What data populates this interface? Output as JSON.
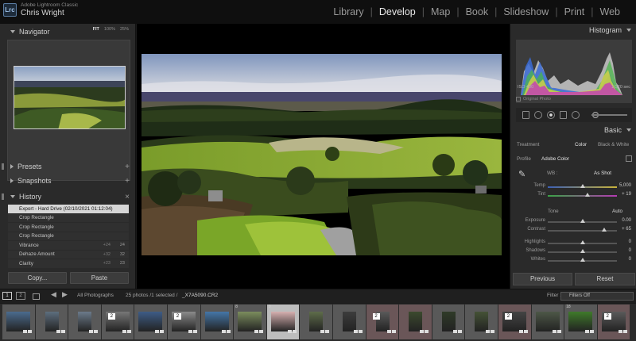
{
  "app": {
    "logo_text": "Lrc",
    "brand": "Adobe Lightroom Classic",
    "user": "Chris Wright",
    "modules": [
      "Library",
      "Develop",
      "Map",
      "Book",
      "Slideshow",
      "Print",
      "Web"
    ],
    "active_module": "Develop"
  },
  "left_panel": {
    "navigator": {
      "title": "Navigator",
      "zoom_options": [
        "FIT",
        "100%",
        "25%"
      ]
    },
    "presets": {
      "title": "Presets"
    },
    "snapshots": {
      "title": "Snapshots"
    },
    "history": {
      "title": "History",
      "items": [
        {
          "label": "Export - Hard Drive (02/10/2021 01:12:04)",
          "delta": "",
          "value": ""
        },
        {
          "label": "Crop Rectangle",
          "delta": "",
          "value": ""
        },
        {
          "label": "Crop Rectangle",
          "delta": "",
          "value": ""
        },
        {
          "label": "Crop Rectangle",
          "delta": "",
          "value": ""
        },
        {
          "label": "Vibrance",
          "delta": "+24",
          "value": "24"
        },
        {
          "label": "Dehaze Amount",
          "delta": "+32",
          "value": "32"
        },
        {
          "label": "Clarity",
          "delta": "+23",
          "value": "23"
        }
      ]
    },
    "copy_label": "Copy...",
    "paste_label": "Paste"
  },
  "right_panel": {
    "histogram": {
      "title": "Histogram",
      "iso": "ISO 400",
      "focal": "124 mm",
      "aperture": "f / 10",
      "shutter": "1/320 sec",
      "original_photo": "Original Photo"
    },
    "basic": {
      "title": "Basic",
      "treatment_label": "Treatment",
      "treatment_color": "Color",
      "treatment_bw": "Black & White",
      "profile_label": "Profile",
      "profile_value": "Adobe Color",
      "wb_label": "WB :",
      "wb_value": "As Shot",
      "tone_label": "Tone",
      "tone_auto": "Auto",
      "sliders": [
        {
          "name": "Temp",
          "value": "5,000",
          "pos": 0.5,
          "gradient": "linear-gradient(90deg,#3b5fb5,#c9b33a)"
        },
        {
          "name": "Tint",
          "value": "+ 19",
          "pos": 0.57,
          "gradient": "linear-gradient(90deg,#3aa346,#b53ab3)"
        },
        {
          "name": "Exposure",
          "value": "0.00",
          "pos": 0.5,
          "gradient": ""
        },
        {
          "name": "Contrast",
          "value": "+ 65",
          "pos": 0.82,
          "gradient": ""
        },
        {
          "name": "Highlights",
          "value": "0",
          "pos": 0.5,
          "gradient": ""
        },
        {
          "name": "Shadows",
          "value": "0",
          "pos": 0.5,
          "gradient": ""
        },
        {
          "name": "Whites",
          "value": "0",
          "pos": 0.5,
          "gradient": ""
        }
      ]
    },
    "previous_label": "Previous",
    "reset_label": "Reset"
  },
  "filmbar": {
    "screen1": "1",
    "screen2": "2",
    "source": "All Photographs",
    "count": "25 photos /1 selected /",
    "filename": "_X7A5090.CR2",
    "filter_label": "Filter :",
    "filter_value": "Filters Off"
  },
  "filmstrip": [
    {
      "num": "",
      "badge": "",
      "style": "landscape",
      "color": "#4b6b8e",
      "tint": ""
    },
    {
      "num": "",
      "badge": "",
      "style": "portrait",
      "color": "#5d6e7e",
      "tint": ""
    },
    {
      "num": "",
      "badge": "",
      "style": "portrait",
      "color": "#6b7a8a",
      "tint": ""
    },
    {
      "num": "",
      "badge": "2",
      "style": "landscape",
      "color": "#777",
      "tint": ""
    },
    {
      "num": "",
      "badge": "",
      "style": "landscape",
      "color": "#3e5c86",
      "tint": ""
    },
    {
      "num": "",
      "badge": "2",
      "style": "landscape",
      "color": "#8a8a8a",
      "tint": ""
    },
    {
      "num": "",
      "badge": "",
      "style": "landscape",
      "color": "#4576a8",
      "tint": ""
    },
    {
      "num": "8",
      "badge": "",
      "style": "landscape",
      "color": "#7b8d5d",
      "tint": ""
    },
    {
      "num": "9",
      "badge": "",
      "style": "landscape",
      "color": "#d6b0b0",
      "tint": "sel"
    },
    {
      "num": "",
      "badge": "",
      "style": "portrait",
      "color": "#5e6c4a",
      "tint": ""
    },
    {
      "num": "",
      "badge": "",
      "style": "portrait",
      "color": "#3d3d3d",
      "tint": ""
    },
    {
      "num": "",
      "badge": "2",
      "style": "portrait",
      "color": "#595959",
      "tint": "pink"
    },
    {
      "num": "",
      "badge": "",
      "style": "portrait",
      "color": "#3c4a2e",
      "tint": "pink"
    },
    {
      "num": "",
      "badge": "",
      "style": "portrait",
      "color": "#2f3b28",
      "tint": ""
    },
    {
      "num": "",
      "badge": "",
      "style": "portrait",
      "color": "#455236",
      "tint": ""
    },
    {
      "num": "",
      "badge": "2",
      "style": "landscape",
      "color": "#444",
      "tint": "pink"
    },
    {
      "num": "",
      "badge": "",
      "style": "landscape",
      "color": "#4d5747",
      "tint": ""
    },
    {
      "num": "18",
      "badge": "",
      "style": "landscape",
      "color": "#3f7a2a",
      "tint": ""
    },
    {
      "num": "",
      "badge": "2",
      "style": "landscape",
      "color": "#5a5a5a",
      "tint": "pink"
    }
  ]
}
